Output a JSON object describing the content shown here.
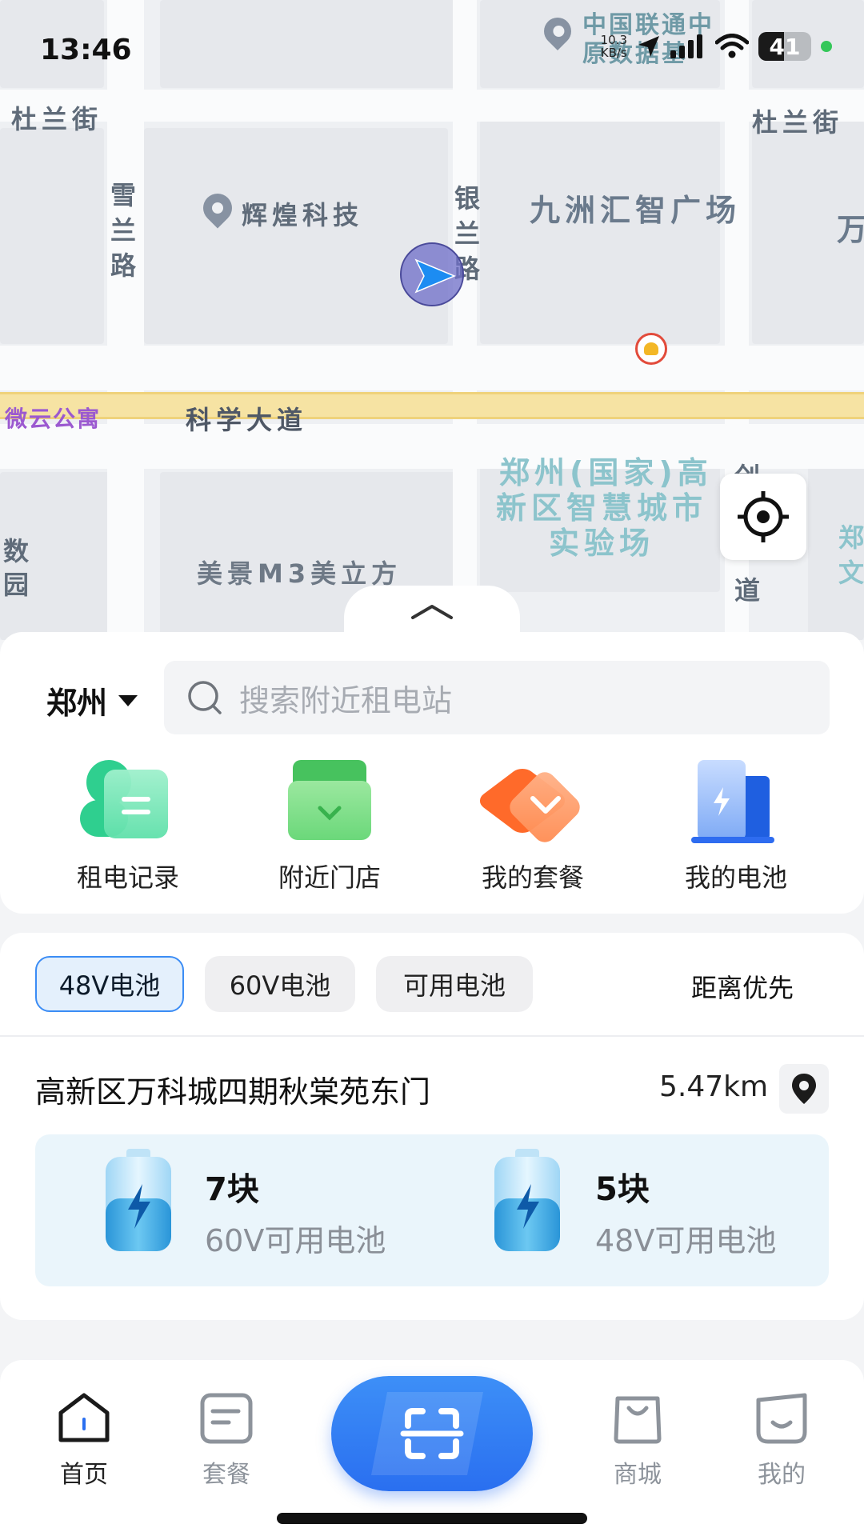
{
  "status_bar": {
    "time": "13:46",
    "speed_value": "10.3",
    "speed_unit": "KB/s",
    "battery_level": "41"
  },
  "map": {
    "labels": {
      "dulan_left": "杜兰街",
      "dulan_right": "杜兰街",
      "xuelan_road": "雪兰路",
      "yinlan_road": "银兰路",
      "huihuang": "辉煌科技",
      "jiuzhou": "九洲汇智广场",
      "wan": "万",
      "weiyun": "微云公寓",
      "kexue": "科学大道",
      "zhengzhou_zone": "郑州(国家)高新区智慧城市实验场",
      "zone_line1": "郑州(国家)高",
      "zone_line2": "新区智慧城市",
      "zone_line3": "实验场",
      "meijing": "美景M3美立方",
      "shuyuan_1": "数",
      "shuyuan_2": "园",
      "chuang_1": "创",
      "dao": "道",
      "zheng_1": "郑",
      "zheng_2": "文",
      "unicom_1": "中国联通中",
      "unicom_2": "原数据基"
    }
  },
  "header": {
    "city": "郑州",
    "search_placeholder": "搜索附近租电站"
  },
  "quick_actions": [
    {
      "label": "租电记录",
      "icon": "rental-record-icon"
    },
    {
      "label": "附近门店",
      "icon": "nearby-store-icon"
    },
    {
      "label": "我的套餐",
      "icon": "my-package-icon"
    },
    {
      "label": "我的电池",
      "icon": "my-battery-icon"
    }
  ],
  "filters": {
    "chips": [
      "48V电池",
      "60V电池",
      "可用电池"
    ],
    "active_index": 0,
    "sort": "距离优先"
  },
  "station": {
    "name": "高新区万科城四期秋棠苑东门",
    "distance": "5.47km",
    "availability": [
      {
        "count": "7块",
        "type": "60V可用电池"
      },
      {
        "count": "5块",
        "type": "48V可用电池"
      }
    ]
  },
  "bottom_nav": {
    "home": "首页",
    "package": "套餐",
    "mall": "商城",
    "mine": "我的"
  },
  "colors": {
    "accent": "#3b8cf5",
    "scan_button": "#2a6ff0",
    "main_road": "#f6e3a3"
  }
}
